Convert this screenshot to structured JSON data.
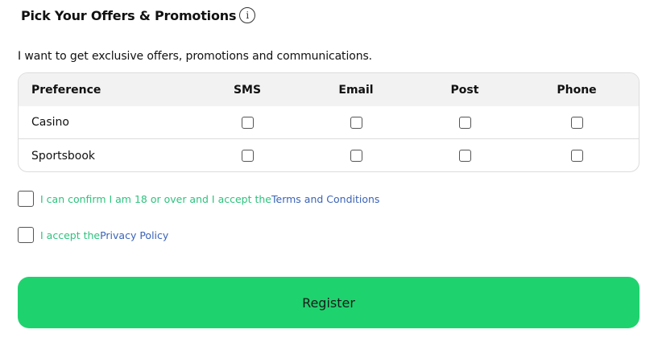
{
  "header": {
    "title": "Pick Your Offers & Promotions",
    "info_glyph": "i",
    "info_icon": "info-icon"
  },
  "intro_text": "I want to get exclusive offers, promotions and communications.",
  "preferences": {
    "columns": [
      "Preference",
      "SMS",
      "Email",
      "Post",
      "Phone"
    ],
    "rows": [
      {
        "label": "Casino",
        "sms": false,
        "email": false,
        "post": false,
        "phone": false
      },
      {
        "label": "Sportsbook",
        "sms": false,
        "email": false,
        "post": false,
        "phone": false
      }
    ]
  },
  "consents": {
    "age": {
      "text": "I can confirm I am 18 or over and I accept the ",
      "link": "Terms and Conditions",
      "checked": false
    },
    "privacy": {
      "text": "I accept the ",
      "link": "Privacy Policy",
      "checked": false
    }
  },
  "register_label": "Register",
  "colors": {
    "accent_green": "#1ed36e",
    "consent_text": "#2ec27e",
    "link_blue": "#3a63b8",
    "table_header_bg": "#f2f2f2"
  }
}
